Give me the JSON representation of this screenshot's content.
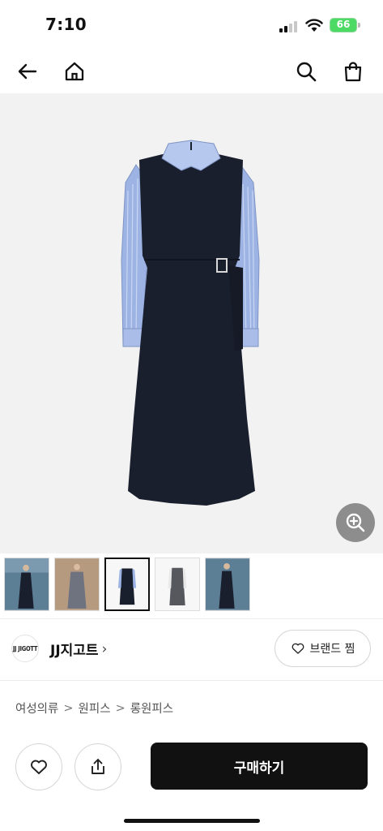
{
  "status_bar": {
    "time": "7:10",
    "battery_level": "66",
    "icons": [
      "signal-icon",
      "wifi-icon",
      "battery-icon"
    ]
  },
  "nav": {
    "icons": [
      "back-arrow-icon",
      "home-icon",
      "search-icon",
      "shopping-bag-icon"
    ]
  },
  "hero": {
    "image_subject": "dress",
    "background_color": "#f2f2f2",
    "zoom_icon": "zoom-in-icon"
  },
  "thumbnails": [
    {
      "id": 1,
      "active": false,
      "bg": "#5d7f96"
    },
    {
      "id": 2,
      "active": false,
      "bg": "#b59a80"
    },
    {
      "id": 3,
      "active": true,
      "bg": "#f7f7f7"
    },
    {
      "id": 4,
      "active": false,
      "bg": "#f7f7f7"
    },
    {
      "id": 5,
      "active": false,
      "bg": "#5d7f96"
    }
  ],
  "brand": {
    "logo_text": "JJ JIGOTT",
    "name": "JJ지고트",
    "chevron": "›",
    "like_label": "브랜드 찜"
  },
  "breadcrumb": [
    "여성의류",
    "원피스",
    "롱원피스"
  ],
  "breadcrumb_separator": ">",
  "bottom": {
    "buy_label": "구매하기",
    "icons": [
      "heart-icon",
      "share-icon"
    ]
  },
  "colors": {
    "accent": "#111111",
    "battery": "#4cd964",
    "zoom_button": "#8d8d8d"
  }
}
